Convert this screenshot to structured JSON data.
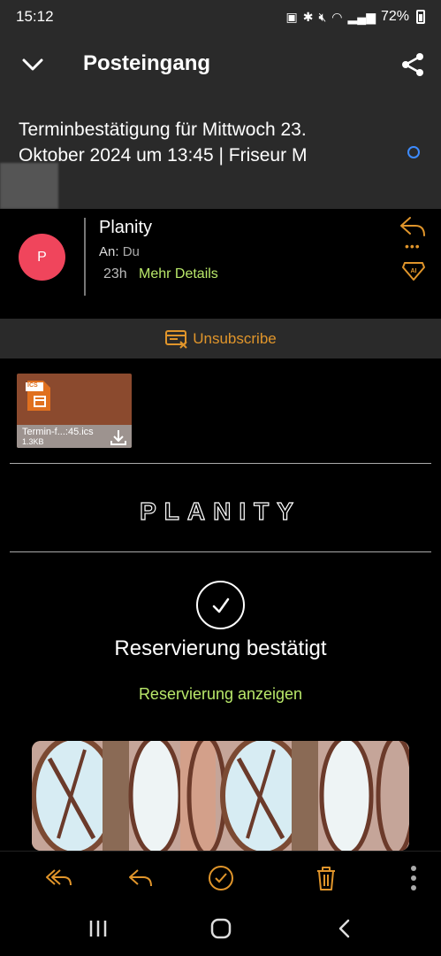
{
  "status": {
    "time": "15:12",
    "battery": "72%"
  },
  "header": {
    "title": "Posteingang"
  },
  "email": {
    "subject": "Terminbestätigung für Mittwoch 23.\nOktober 2024 um 13:45 | Friseur M",
    "sender_initial": "P",
    "sender_name": "Planity",
    "to_label": "An:",
    "to_value": "Du",
    "time_ago": "23h",
    "more_details": "Mehr Details"
  },
  "unsubscribe": {
    "label": "Unsubscribe"
  },
  "attachment": {
    "badge": "ICS",
    "filename": "Termin-f...:45.ics",
    "size": "1.3KB"
  },
  "body": {
    "logo": "PLANITY",
    "confirmed": "Reservierung bestätigt",
    "view_link": "Reservierung anzeigen"
  },
  "colors": {
    "accent": "#e0952b",
    "link": "#b9e86a",
    "avatar": "#f0455c",
    "bar_bg": "#2a2a2a"
  }
}
